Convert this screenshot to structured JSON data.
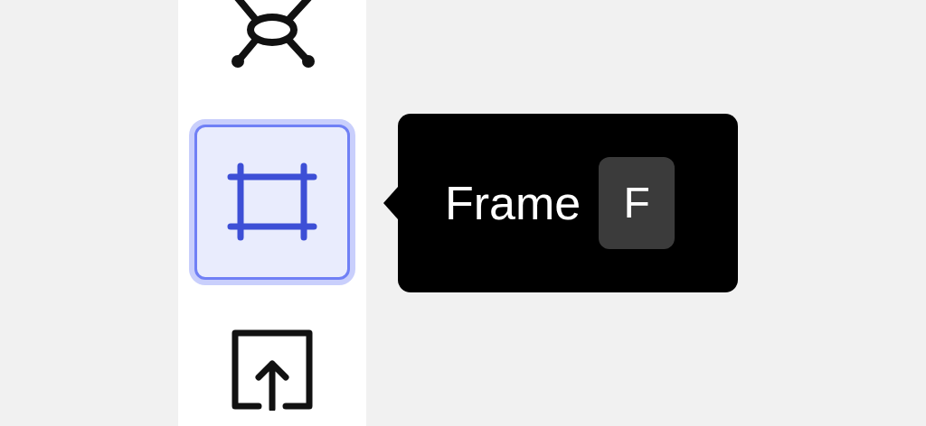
{
  "toolbar": {
    "items": [
      {
        "kind": "connector",
        "selected": false
      },
      {
        "kind": "frame",
        "selected": true
      },
      {
        "kind": "upload",
        "selected": false
      }
    ]
  },
  "tooltip": {
    "label": "Frame",
    "shortcut": "F"
  }
}
